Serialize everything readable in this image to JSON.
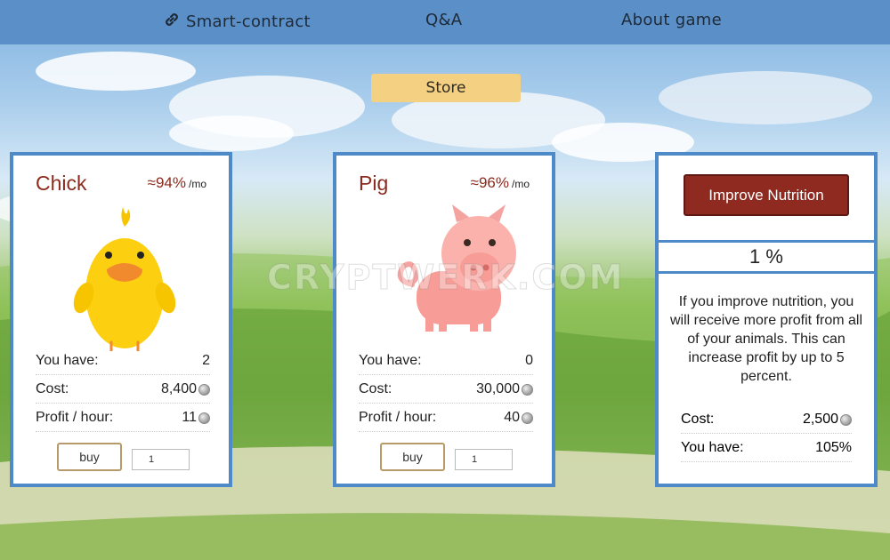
{
  "nav": {
    "smart_contract": "Smart-contract",
    "qa": "Q&A",
    "about": "About game"
  },
  "store_label": "Store",
  "watermark": "CRYPTWERK.COM",
  "cards": [
    {
      "name": "Chick",
      "rate": "≈94%",
      "per": "/mo",
      "you_have_label": "You have:",
      "you_have": "2",
      "cost_label": "Cost:",
      "cost": "8,400",
      "profit_label": "Profit / hour:",
      "profit": "11",
      "buy_label": "buy",
      "quantity": "1"
    },
    {
      "name": "Pig",
      "rate": "≈96%",
      "per": "/mo",
      "you_have_label": "You have:",
      "you_have": "0",
      "cost_label": "Cost:",
      "cost": "30,000",
      "profit_label": "Profit / hour:",
      "profit": "40",
      "buy_label": "buy",
      "quantity": "1"
    }
  ],
  "nutrition": {
    "button_label": "Improve Nutrition",
    "percent": "1 %",
    "description": "If you improve nutrition, you will receive more profit from all of your animals. This can increase profit by up to 5 percent.",
    "cost_label": "Cost:",
    "cost": "2,500",
    "you_have_label": "You have:",
    "you_have": "105%"
  },
  "colors": {
    "nav_bg": "#5b8fc7",
    "card_border": "#4d8ac7",
    "title_red": "#8b2a1e",
    "button_red": "#8f2a20",
    "store_yellow": "#f4d083"
  }
}
